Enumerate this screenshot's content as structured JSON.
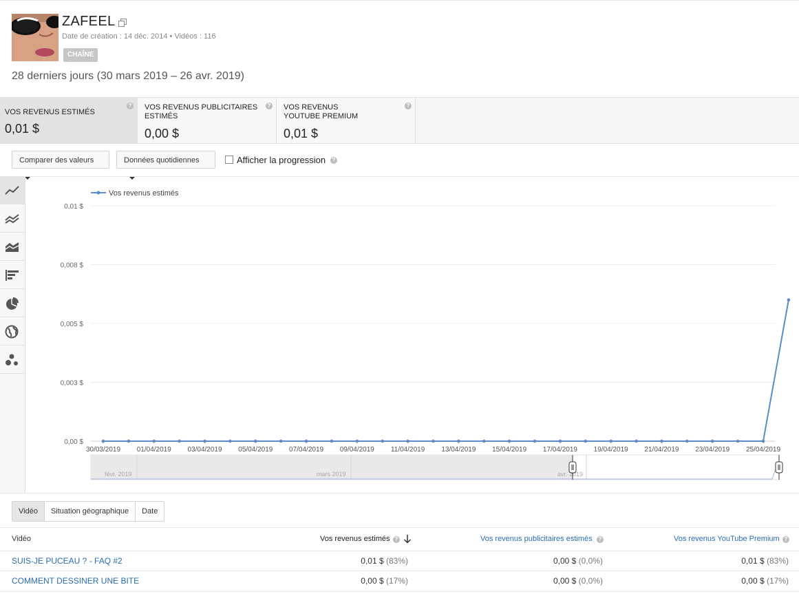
{
  "channel": {
    "name": "ZAFEEL",
    "meta": "Date de création : 14 déc. 2014  •  Vidéos : 116",
    "badge": "CHAÎNE"
  },
  "period": "28 derniers jours (30 mars 2019 – 26 avr. 2019)",
  "metrics": [
    {
      "label": "VOS REVENUS ESTIMÉS",
      "value": "0,01 $"
    },
    {
      "label": "VOS REVENUS PUBLICITAIRES ESTIMÉS",
      "value": "0,00 $"
    },
    {
      "label": "VOS REVENUS YOUTUBE PREMIUM",
      "value": "0,01 $"
    }
  ],
  "controls": {
    "compare": "Comparer des valeurs",
    "granularity": "Données quotidiennes",
    "progress_label": "Afficher la progression"
  },
  "chart_tools": [
    "line-chart-icon",
    "multi-line-icon",
    "stacked-area-icon",
    "bar-chart-icon",
    "pie-chart-icon",
    "globe-icon",
    "bubble-chart-icon"
  ],
  "chart_data": {
    "type": "line",
    "legend": "Vos revenus estimés",
    "ylim": [
      0,
      0.01
    ],
    "yticks": [
      "0,00 $",
      "0,003 $",
      "0,005 $",
      "0,008 $",
      "0,01 $"
    ],
    "x_labels": [
      "30/03/2019",
      "01/04/2019",
      "03/04/2019",
      "05/04/2019",
      "07/04/2019",
      "09/04/2019",
      "11/04/2019",
      "13/04/2019",
      "15/04/2019",
      "17/04/2019",
      "19/04/2019",
      "21/04/2019",
      "23/04/2019",
      "25/04/2019"
    ],
    "x": [
      "30/03/2019",
      "31/03/2019",
      "01/04/2019",
      "02/04/2019",
      "03/04/2019",
      "04/04/2019",
      "05/04/2019",
      "06/04/2019",
      "07/04/2019",
      "08/04/2019",
      "09/04/2019",
      "10/04/2019",
      "11/04/2019",
      "12/04/2019",
      "13/04/2019",
      "14/04/2019",
      "15/04/2019",
      "16/04/2019",
      "17/04/2019",
      "18/04/2019",
      "19/04/2019",
      "20/04/2019",
      "21/04/2019",
      "22/04/2019",
      "23/04/2019",
      "24/04/2019",
      "25/04/2019",
      "26/04/2019"
    ],
    "series": [
      {
        "name": "Vos revenus estimés",
        "values": [
          0,
          0,
          0,
          0,
          0,
          0,
          0,
          0,
          0,
          0,
          0,
          0,
          0,
          0,
          0,
          0,
          0,
          0,
          0,
          0,
          0,
          0,
          0,
          0,
          0,
          0,
          0,
          0.006
        ]
      }
    ],
    "color": "#5b8bc9",
    "grid": true,
    "navigator_labels": [
      "févr. 2019",
      "mars 2019",
      "avr. 2019"
    ]
  },
  "table_tabs": [
    "Vidéo",
    "Situation géographique",
    "Date"
  ],
  "table": {
    "headers": [
      "Vidéo",
      "Vos revenus estimés",
      "Vos revenus publicitaires estimés",
      "Vos revenus YouTube Premium"
    ],
    "rows": [
      {
        "title": "SUIS-JE PUCEAU ? - FAQ #2",
        "rev": "0,01 $",
        "rev_pct": "(83%)",
        "ads": "0,00 $",
        "ads_pct": "(0,0%)",
        "prem": "0,01 $",
        "prem_pct": "(83%)"
      },
      {
        "title": "COMMENT DESSINER UNE BITE",
        "rev": "0,00 $",
        "rev_pct": "(17%)",
        "ads": "0,00 $",
        "ads_pct": "(0,0%)",
        "prem": "0,00 $",
        "prem_pct": "(17%)"
      }
    ]
  }
}
